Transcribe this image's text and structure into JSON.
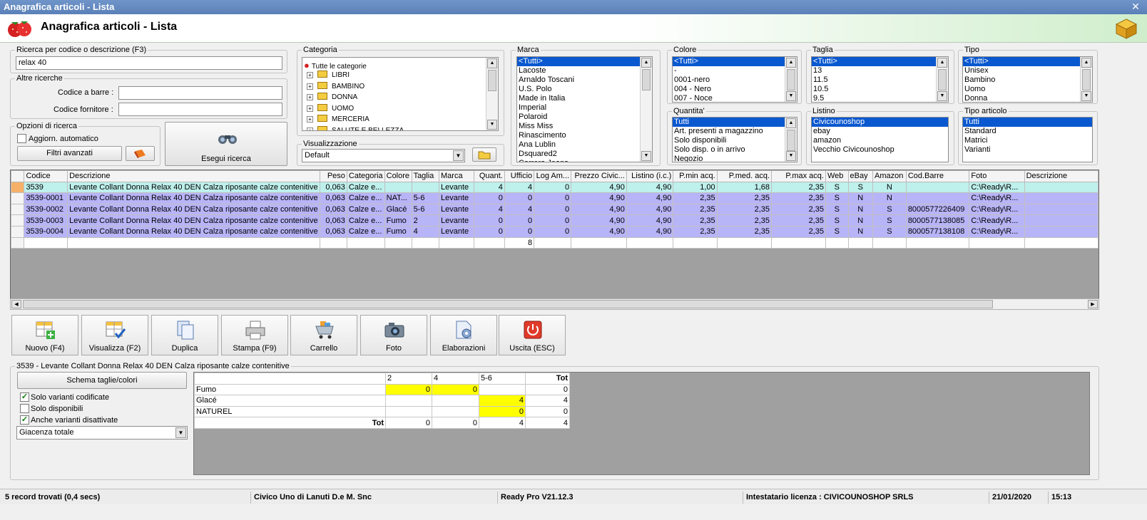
{
  "window": {
    "title": "Anagrafica articoli  - Lista"
  },
  "header": {
    "title": "Anagrafica articoli  - Lista"
  },
  "search": {
    "legend": "Ricerca per codice o descrizione (F3)",
    "value": "relax 40"
  },
  "other_search": {
    "legend": "Altre ricerche",
    "barcode_label": "Codice a barre :",
    "barcode_value": "",
    "supplier_label": "Codice fornitore :",
    "supplier_value": ""
  },
  "options": {
    "legend": "Opzioni di ricerca",
    "auto_update_label": "Aggiorn. automatico",
    "auto_update_checked": false,
    "advanced_filters_label": "Filtri avanzati"
  },
  "run_search_label": "Esegui ricerca",
  "category": {
    "legend": "Categoria",
    "root": "Tutte le categorie",
    "items": [
      "LIBRI",
      "BAMBINO",
      "DONNA",
      "UOMO",
      "MERCERIA",
      "SALUTE E BELLEZZA"
    ]
  },
  "view": {
    "legend": "Visualizzazione",
    "value": "Default"
  },
  "brand": {
    "legend": "Marca",
    "items": [
      "<Tutti>",
      "Lacoste",
      "Arnaldo Toscani",
      "U.S. Polo",
      "Made in Italia",
      "Imperial",
      "Polaroid",
      "Miss Miss",
      "Rinascimento",
      "Ana Lublin",
      "Dsquared2",
      "Carrera Jeans"
    ],
    "selected": "<Tutti>"
  },
  "color": {
    "legend": "Colore",
    "items": [
      "<Tutti>",
      "-",
      "0001-nero",
      "004 - Nero",
      "007 - Noce"
    ],
    "selected": "<Tutti>"
  },
  "size": {
    "legend": "Taglia",
    "items": [
      "<Tutti>",
      "13",
      "11.5",
      "10.5",
      "9.5"
    ],
    "selected": "<Tutti>"
  },
  "type": {
    "legend": "Tipo",
    "items": [
      "<Tutti>",
      "Unisex",
      "Bambino",
      "Uomo",
      "Donna"
    ],
    "selected": "<Tutti>"
  },
  "quantity": {
    "legend": "Quantita'",
    "items": [
      "Tutti",
      "Art. presenti a magazzino",
      "Solo disponibili",
      "Solo disp. o in arrivo",
      "Negozio"
    ],
    "selected": "Tutti"
  },
  "pricelist": {
    "legend": "Listino",
    "items": [
      "Civicounoshop",
      "ebay",
      "amazon",
      "Vecchio Civicounoshop"
    ],
    "selected": "Civicounoshop"
  },
  "article_type": {
    "legend": "Tipo articolo",
    "items": [
      "Tutti",
      "Standard",
      "Matrici",
      "Varianti"
    ],
    "selected": "Tutti"
  },
  "grid": {
    "columns": [
      "",
      "Codice",
      "Descrizione",
      "Peso",
      "Categoria",
      "Colore",
      "Taglia",
      "Marca",
      "Quant.",
      "Ufficio",
      "Log Am...",
      "Prezzo Civic...",
      "Listino (i.c.)",
      "P.min acq.",
      "P.med. acq.",
      "P.max acq.",
      "Web",
      "eBay",
      "Amazon",
      "Cod.Barre",
      "Foto",
      "Descrizione"
    ],
    "rows": [
      {
        "codice": "3539",
        "descrizione": "Levante Collant Donna Relax 40 DEN Calza riposante calze contenitive",
        "peso": "0,063",
        "categoria": "Calze e...",
        "colore": "",
        "taglia": "",
        "marca": "Levante",
        "quant": "4",
        "ufficio": "4",
        "log": "0",
        "prezzo": "4,90",
        "listino": "4,90",
        "pmin": "1,00",
        "pmed": "1,68",
        "pmax": "2,35",
        "web": "S",
        "ebay": "S",
        "amazon": "N",
        "barre": "",
        "foto": "C:\\Ready\\R...",
        "desc2": ""
      },
      {
        "codice": "3539-0001",
        "descrizione": "Levante Collant Donna Relax 40 DEN Calza riposante calze contenitive",
        "peso": "0,063",
        "categoria": "Calze e...",
        "colore": "NAT...",
        "taglia": "5-6",
        "marca": "Levante",
        "quant": "0",
        "ufficio": "0",
        "log": "0",
        "prezzo": "4,90",
        "listino": "4,90",
        "pmin": "2,35",
        "pmed": "2,35",
        "pmax": "2,35",
        "web": "S",
        "ebay": "N",
        "amazon": "N",
        "barre": "",
        "foto": "C:\\Ready\\R...",
        "desc2": ""
      },
      {
        "codice": "3539-0002",
        "descrizione": "Levante Collant Donna Relax 40 DEN Calza riposante calze contenitive",
        "peso": "0,063",
        "categoria": "Calze e...",
        "colore": "Glacé",
        "taglia": "5-6",
        "marca": "Levante",
        "quant": "4",
        "ufficio": "4",
        "log": "0",
        "prezzo": "4,90",
        "listino": "4,90",
        "pmin": "2,35",
        "pmed": "2,35",
        "pmax": "2,35",
        "web": "S",
        "ebay": "N",
        "amazon": "S",
        "barre": "8000577226409",
        "foto": "C:\\Ready\\R...",
        "desc2": ""
      },
      {
        "codice": "3539-0003",
        "descrizione": "Levante Collant Donna Relax 40 DEN Calza riposante calze contenitive",
        "peso": "0,063",
        "categoria": "Calze e...",
        "colore": "Fumo",
        "taglia": "2",
        "marca": "Levante",
        "quant": "0",
        "ufficio": "0",
        "log": "0",
        "prezzo": "4,90",
        "listino": "4,90",
        "pmin": "2,35",
        "pmed": "2,35",
        "pmax": "2,35",
        "web": "S",
        "ebay": "N",
        "amazon": "S",
        "barre": "8000577138085",
        "foto": "C:\\Ready\\R...",
        "desc2": ""
      },
      {
        "codice": "3539-0004",
        "descrizione": "Levante Collant Donna Relax 40 DEN Calza riposante calze contenitive",
        "peso": "0,063",
        "categoria": "Calze e...",
        "colore": "Fumo",
        "taglia": "4",
        "marca": "Levante",
        "quant": "0",
        "ufficio": "0",
        "log": "0",
        "prezzo": "4,90",
        "listino": "4,90",
        "pmin": "2,35",
        "pmed": "2,35",
        "pmax": "2,35",
        "web": "S",
        "ebay": "N",
        "amazon": "S",
        "barre": "8000577138108",
        "foto": "C:\\Ready\\R...",
        "desc2": ""
      }
    ],
    "total_ufficio": "8"
  },
  "toolbar": {
    "new": "Nuovo (F4)",
    "view": "Visualizza (F2)",
    "duplicate": "Duplica",
    "print": "Stampa (F9)",
    "cart": "Carrello",
    "photo": "Foto",
    "process": "Elaborazioni",
    "exit": "Uscita (ESC)"
  },
  "detail": {
    "legend": "3539 - Levante Collant Donna Relax 40 DEN Calza riposante calze contenitive",
    "scheme_button": "Schema taglie/colori",
    "only_coded_label": "Solo varianti codificate",
    "only_coded_checked": true,
    "only_available_label": "Solo disponibili",
    "only_available_checked": false,
    "also_disabled_label": "Anche varianti disattivate",
    "also_disabled_checked": true,
    "stock_mode": "Giacenza totale",
    "size_headers": [
      "",
      "2",
      "4",
      "5-6",
      "Tot"
    ],
    "size_rows": [
      {
        "color": "Fumo",
        "cells": [
          "0",
          "0",
          "",
          "0"
        ]
      },
      {
        "color": "Glacé",
        "cells": [
          "",
          "",
          "4",
          "4"
        ]
      },
      {
        "color": "NATUREL",
        "cells": [
          "",
          "",
          "0",
          "0"
        ]
      }
    ],
    "size_total": {
      "label": "Tot",
      "cells": [
        "0",
        "0",
        "4",
        "4"
      ]
    }
  },
  "status": {
    "records": "5 record trovati (0,4 secs)",
    "company": "Civico Uno di Lanuti D.e M. Snc",
    "version": "Ready Pro V21.12.3",
    "license": "Intestatario licenza : CIVICOUNOSHOP SRLS",
    "date": "21/01/2020",
    "time": "15:13"
  },
  "colors": {
    "title_bar": "#6f95c9",
    "current_row": "#bef0ec",
    "variant_row": "#b8b4f8",
    "highlight": "#ffff00",
    "selection": "#0a58cf"
  }
}
